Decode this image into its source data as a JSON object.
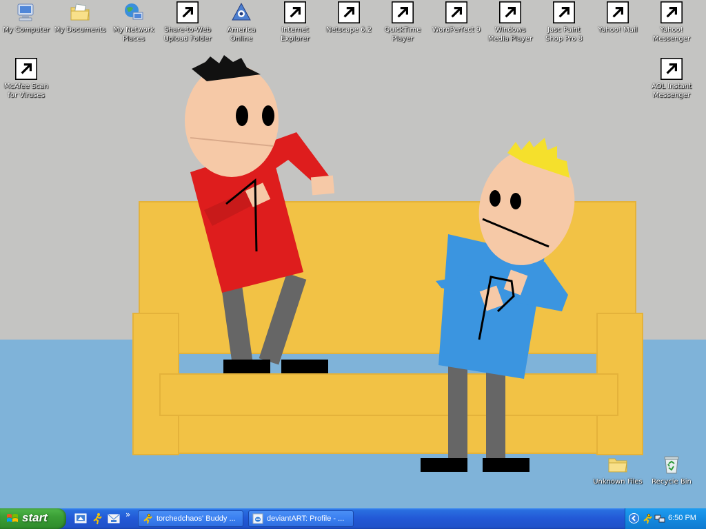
{
  "desktop": {
    "icons": [
      {
        "name": "my-computer-icon",
        "label": "My Computer",
        "glyph": "computer"
      },
      {
        "name": "my-documents-icon",
        "label": "My Documents",
        "glyph": "folder-docs"
      },
      {
        "name": "my-network-places-icon",
        "label": "My Network Places",
        "glyph": "network"
      },
      {
        "name": "share-to-web-icon",
        "label": "Share-to-Web Upload Folder",
        "glyph": "hp"
      },
      {
        "name": "america-online-icon",
        "label": "America Online",
        "glyph": "aol"
      },
      {
        "name": "internet-explorer-icon",
        "label": "Internet Explorer",
        "glyph": "ie"
      },
      {
        "name": "netscape-icon",
        "label": "Netscape 6.2",
        "glyph": "netscape"
      },
      {
        "name": "quicktime-player-icon",
        "label": "QuickTime Player",
        "glyph": "quicktime"
      },
      {
        "name": "wordperfect-icon",
        "label": "WordPerfect 9",
        "glyph": "wordperfect"
      },
      {
        "name": "windows-media-player-icon",
        "label": "Windows Media Player",
        "glyph": "wmp"
      },
      {
        "name": "paint-shop-pro-icon",
        "label": "Jasc Paint Shop Pro 8",
        "glyph": "psp"
      },
      {
        "name": "yahoo-mail-icon",
        "label": "Yahoo! Mail",
        "glyph": "yahoo-mail"
      },
      {
        "name": "yahoo-messenger-icon",
        "label": "Yahoo! Messenger",
        "glyph": "yahoo-messenger"
      },
      {
        "name": "mcafee-scan-icon",
        "label": "McAfee Scan for Viruses",
        "glyph": "mcafee"
      },
      {
        "name": "aol-instant-messenger-icon",
        "label": "AOL Instant Messenger",
        "glyph": "aim"
      },
      {
        "name": "unknown-files-folder-icon",
        "label": "Unknown Files",
        "glyph": "folder"
      },
      {
        "name": "recycle-bin-icon",
        "label": "Recycle Bin",
        "glyph": "recycle"
      }
    ]
  },
  "taskbar": {
    "start_label": "start",
    "quick_launch": [
      {
        "name": "show-desktop-icon"
      },
      {
        "name": "aim-quick-launch-icon"
      },
      {
        "name": "outlook-express-icon"
      }
    ],
    "more_label": "»",
    "tasks": [
      {
        "label": "torchedchaos' Buddy ...",
        "icon": "aim-running-icon"
      },
      {
        "label": "deviantART: Profile - ...",
        "icon": "ie-window-icon"
      }
    ],
    "tray": {
      "clock": "6:50 PM"
    }
  },
  "colors": {
    "wall": "#c4c4c2",
    "floor": "#7fb3d9",
    "couch": "#f2c245",
    "taskbar_blue": "#2258d6",
    "start_green": "#3b9f36"
  }
}
